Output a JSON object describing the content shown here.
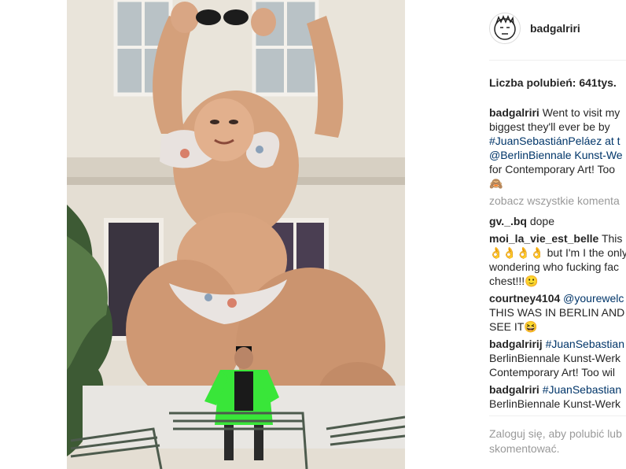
{
  "post": {
    "username": "badgalriri",
    "likes": "Liczba polubień: 641tys.",
    "caption": {
      "username": "badgalriri",
      "lines": [
        "Went to visit my",
        "biggest they'll ever be by",
        "#JuanSebastiánPeláez at t",
        "@BerlinBiennale Kunst-We",
        "for Contemporary Art! Too",
        "🙈"
      ]
    },
    "view_all_comments": "zobacz wszystkie komenta",
    "comments": [
      {
        "username": "gv._.bq",
        "lines": [
          "dope"
        ]
      },
      {
        "username": "moi_la_vie_est_belle",
        "lines": [
          "This",
          "👌👌👌👌 but I'm I the only",
          "wondering who fucking fac",
          "chest!!!🙂"
        ]
      },
      {
        "username": "courtney4104",
        "lines": [
          "@yourewelc",
          "THIS WAS IN BERLIN AND",
          "SEE IT😆"
        ]
      },
      {
        "username": "badgalririj",
        "lines": [
          "#JuanSebastian",
          "BerlinBiennale Kunst-Werk",
          "Contemporary Art! Too wil"
        ]
      },
      {
        "username": "badgalriri",
        "lines": [
          "#JuanSebastian",
          "BerlinBiennale Kunst-Werk"
        ]
      }
    ],
    "footer": {
      "login_link": "Zaloguj się",
      "rest_line1": ", aby polubić lub",
      "line2": "skomentować."
    }
  },
  "photo": {
    "alt": "photo"
  },
  "colors": {
    "link": "#003569",
    "muted": "#999999",
    "text": "#262626",
    "jacket": "#39e639"
  }
}
